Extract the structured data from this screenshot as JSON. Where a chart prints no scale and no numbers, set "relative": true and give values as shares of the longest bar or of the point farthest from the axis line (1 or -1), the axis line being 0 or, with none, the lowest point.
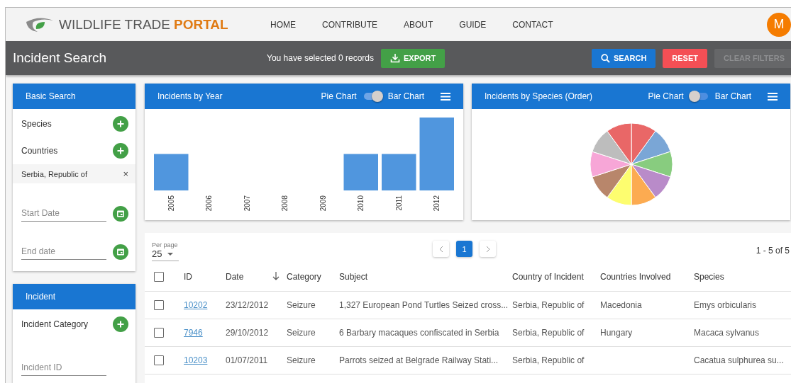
{
  "header": {
    "logo_text": "WILDLIFE TRADE",
    "logo_accent": "PORTAL",
    "nav": [
      {
        "label": "HOME"
      },
      {
        "label": "CONTRIBUTE"
      },
      {
        "label": "ABOUT"
      },
      {
        "label": "GUIDE"
      },
      {
        "label": "CONTACT"
      }
    ],
    "avatar": "M"
  },
  "toolbar": {
    "title": "Incident Search",
    "selection_text": "You have selected 0 records",
    "buttons": [
      {
        "kind": "export",
        "label": "EXPORT",
        "disabled": false
      },
      {
        "kind": "search",
        "label": "SEARCH",
        "disabled": false
      },
      {
        "kind": "reset",
        "label": "RESET",
        "disabled": false
      },
      {
        "kind": "clear",
        "label": "CLEAR FILTERS",
        "disabled": true
      }
    ]
  },
  "basic_search": {
    "title": "Basic Search",
    "filters": [
      {
        "kind": "add",
        "label": "Species"
      },
      {
        "kind": "add",
        "label": "Countries"
      },
      {
        "kind": "chip",
        "label": "Serbia, Republic of",
        "remove": "×"
      },
      {
        "kind": "date",
        "placeholder": "Start Date"
      },
      {
        "kind": "date",
        "placeholder": "End date"
      }
    ]
  },
  "incident": {
    "title": "Incident",
    "filters": [
      {
        "kind": "add",
        "label": "Incident Category"
      },
      {
        "kind": "text",
        "placeholder": "Incident ID"
      }
    ]
  },
  "charts": [
    {
      "title": "Incidents by Year",
      "toggle_left": "Pie Chart",
      "toggle_right": "Bar Chart",
      "bar_chart_on": true,
      "chart_data": {
        "type": "bar",
        "relative": true,
        "categories": [
          "2005",
          "2006",
          "2007",
          "2008",
          "2009",
          "2010",
          "2011",
          "2012"
        ],
        "values": [
          0.5,
          0,
          0,
          0,
          0,
          0.5,
          0.5,
          1
        ]
      }
    },
    {
      "title": "Incidents by Species (Order)",
      "toggle_left": "Pie Chart",
      "toggle_right": "Bar Chart",
      "bar_chart_on": false
    }
  ],
  "table": {
    "per_page_label": "Per page",
    "per_page": "25",
    "pages": [
      {
        "label": "1",
        "selected": true
      }
    ],
    "range": "1 - 5 of 5",
    "select_all_checked": false,
    "columns": [
      {
        "label": "ID",
        "sorted": false
      },
      {
        "label": "Date",
        "sorted": true
      },
      {
        "label": "Category",
        "sorted": false
      },
      {
        "label": "Subject",
        "sorted": false
      },
      {
        "label": "Country of Incident",
        "sorted": false
      },
      {
        "label": "Countries Involved",
        "sorted": false
      },
      {
        "label": "Species",
        "sorted": false
      }
    ],
    "rows": [
      {
        "checked": false,
        "id": "10202",
        "date": "23/12/2012",
        "category": "Seizure",
        "subject": "1,327 European Pond Turtles Seized cross...",
        "country": "Serbia, Republic of",
        "involved": "Macedonia",
        "species": "Emys orbicularis"
      },
      {
        "checked": false,
        "id": "7946",
        "date": "29/10/2012",
        "category": "Seizure",
        "subject": "6 Barbary macaques confiscated in Serbia",
        "country": "Serbia, Republic of",
        "involved": "Hungary",
        "species": "Macaca sylvanus"
      },
      {
        "checked": false,
        "id": "10203",
        "date": "01/07/2011",
        "category": "Seizure",
        "subject": "Parrots seized at Belgrade Railway Stati...",
        "country": "Serbia, Republic of",
        "species": "Cacatua sulphurea su..."
      }
    ]
  }
}
